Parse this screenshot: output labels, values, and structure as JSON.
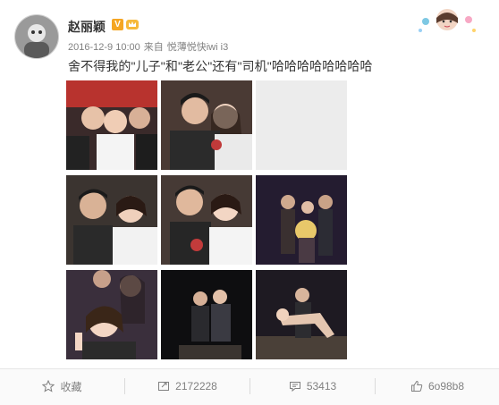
{
  "post": {
    "username": "赵丽颖",
    "badge": "V",
    "date": "2016-12-9 10:00",
    "source_prefix": "来自",
    "source": "悦薄悦快iwi i3",
    "text": "舍不得我的\"儿子\"和\"老公\"还有\"司机\"哈哈哈哈哈哈哈哈"
  },
  "actions": {
    "favorite_label": "收藏",
    "repost_count": "2172228",
    "comment_count": "53413",
    "like_count": "6o98b8"
  },
  "icons": [
    "avatar-image",
    "verified-badge",
    "crown-icon",
    "decorative-sticker",
    "star-icon",
    "repost-icon",
    "comment-icon",
    "thumbs-up-icon"
  ],
  "colors": {
    "accent": "#f5a623",
    "text": "#333333",
    "meta": "#808080",
    "action_bar": "#fafafa"
  }
}
